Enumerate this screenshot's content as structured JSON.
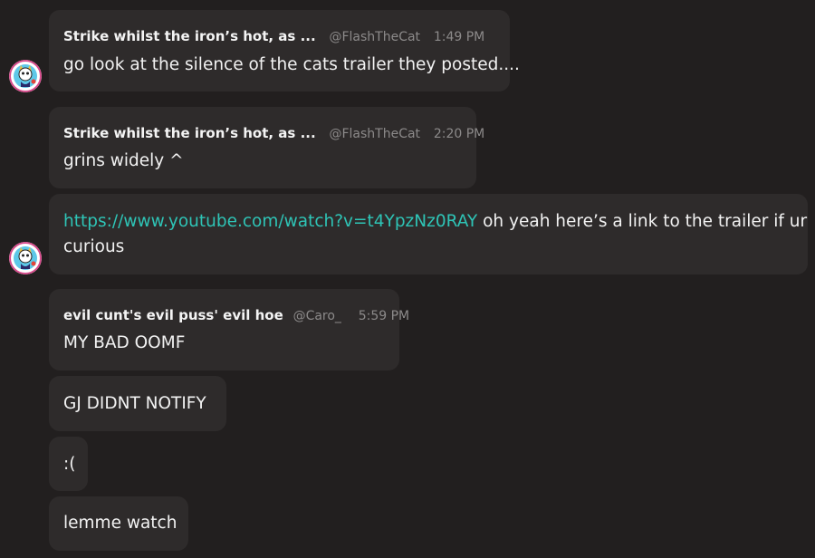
{
  "messages": [
    {
      "author": "Strike whilst the iron’s hot, as ...",
      "handle": "@FlashTheCat",
      "time": "1:49 PM",
      "text": "go look at the silence of the cats trailer they posted...."
    },
    {
      "author": "Strike whilst the iron’s hot, as ...",
      "handle": "@FlashTheCat",
      "time": "2:20 PM",
      "text": "grins widely ^"
    },
    {
      "link": "https://www.youtube.com/watch?v=t4YpzNz0RAY",
      "text_after_link": " oh yeah here’s a link to the trailer if ur",
      "text_line2": "curious"
    },
    {
      "author": "evil cunt's evil puss' evil hoe",
      "handle": "@Caro_",
      "time": "5:59 PM",
      "text": "MY BAD OOMF"
    },
    {
      "text": "GJ DIDNT NOTIFY"
    },
    {
      "text": ":("
    },
    {
      "text": "lemme watch"
    }
  ],
  "colors": {
    "background": "#221f1f",
    "bubble": "#2e2b2b",
    "link": "#2ec4b6",
    "muted": "#8c8a8a"
  },
  "icons": {
    "avatar": "cartoon-cat-avatar-icon"
  }
}
